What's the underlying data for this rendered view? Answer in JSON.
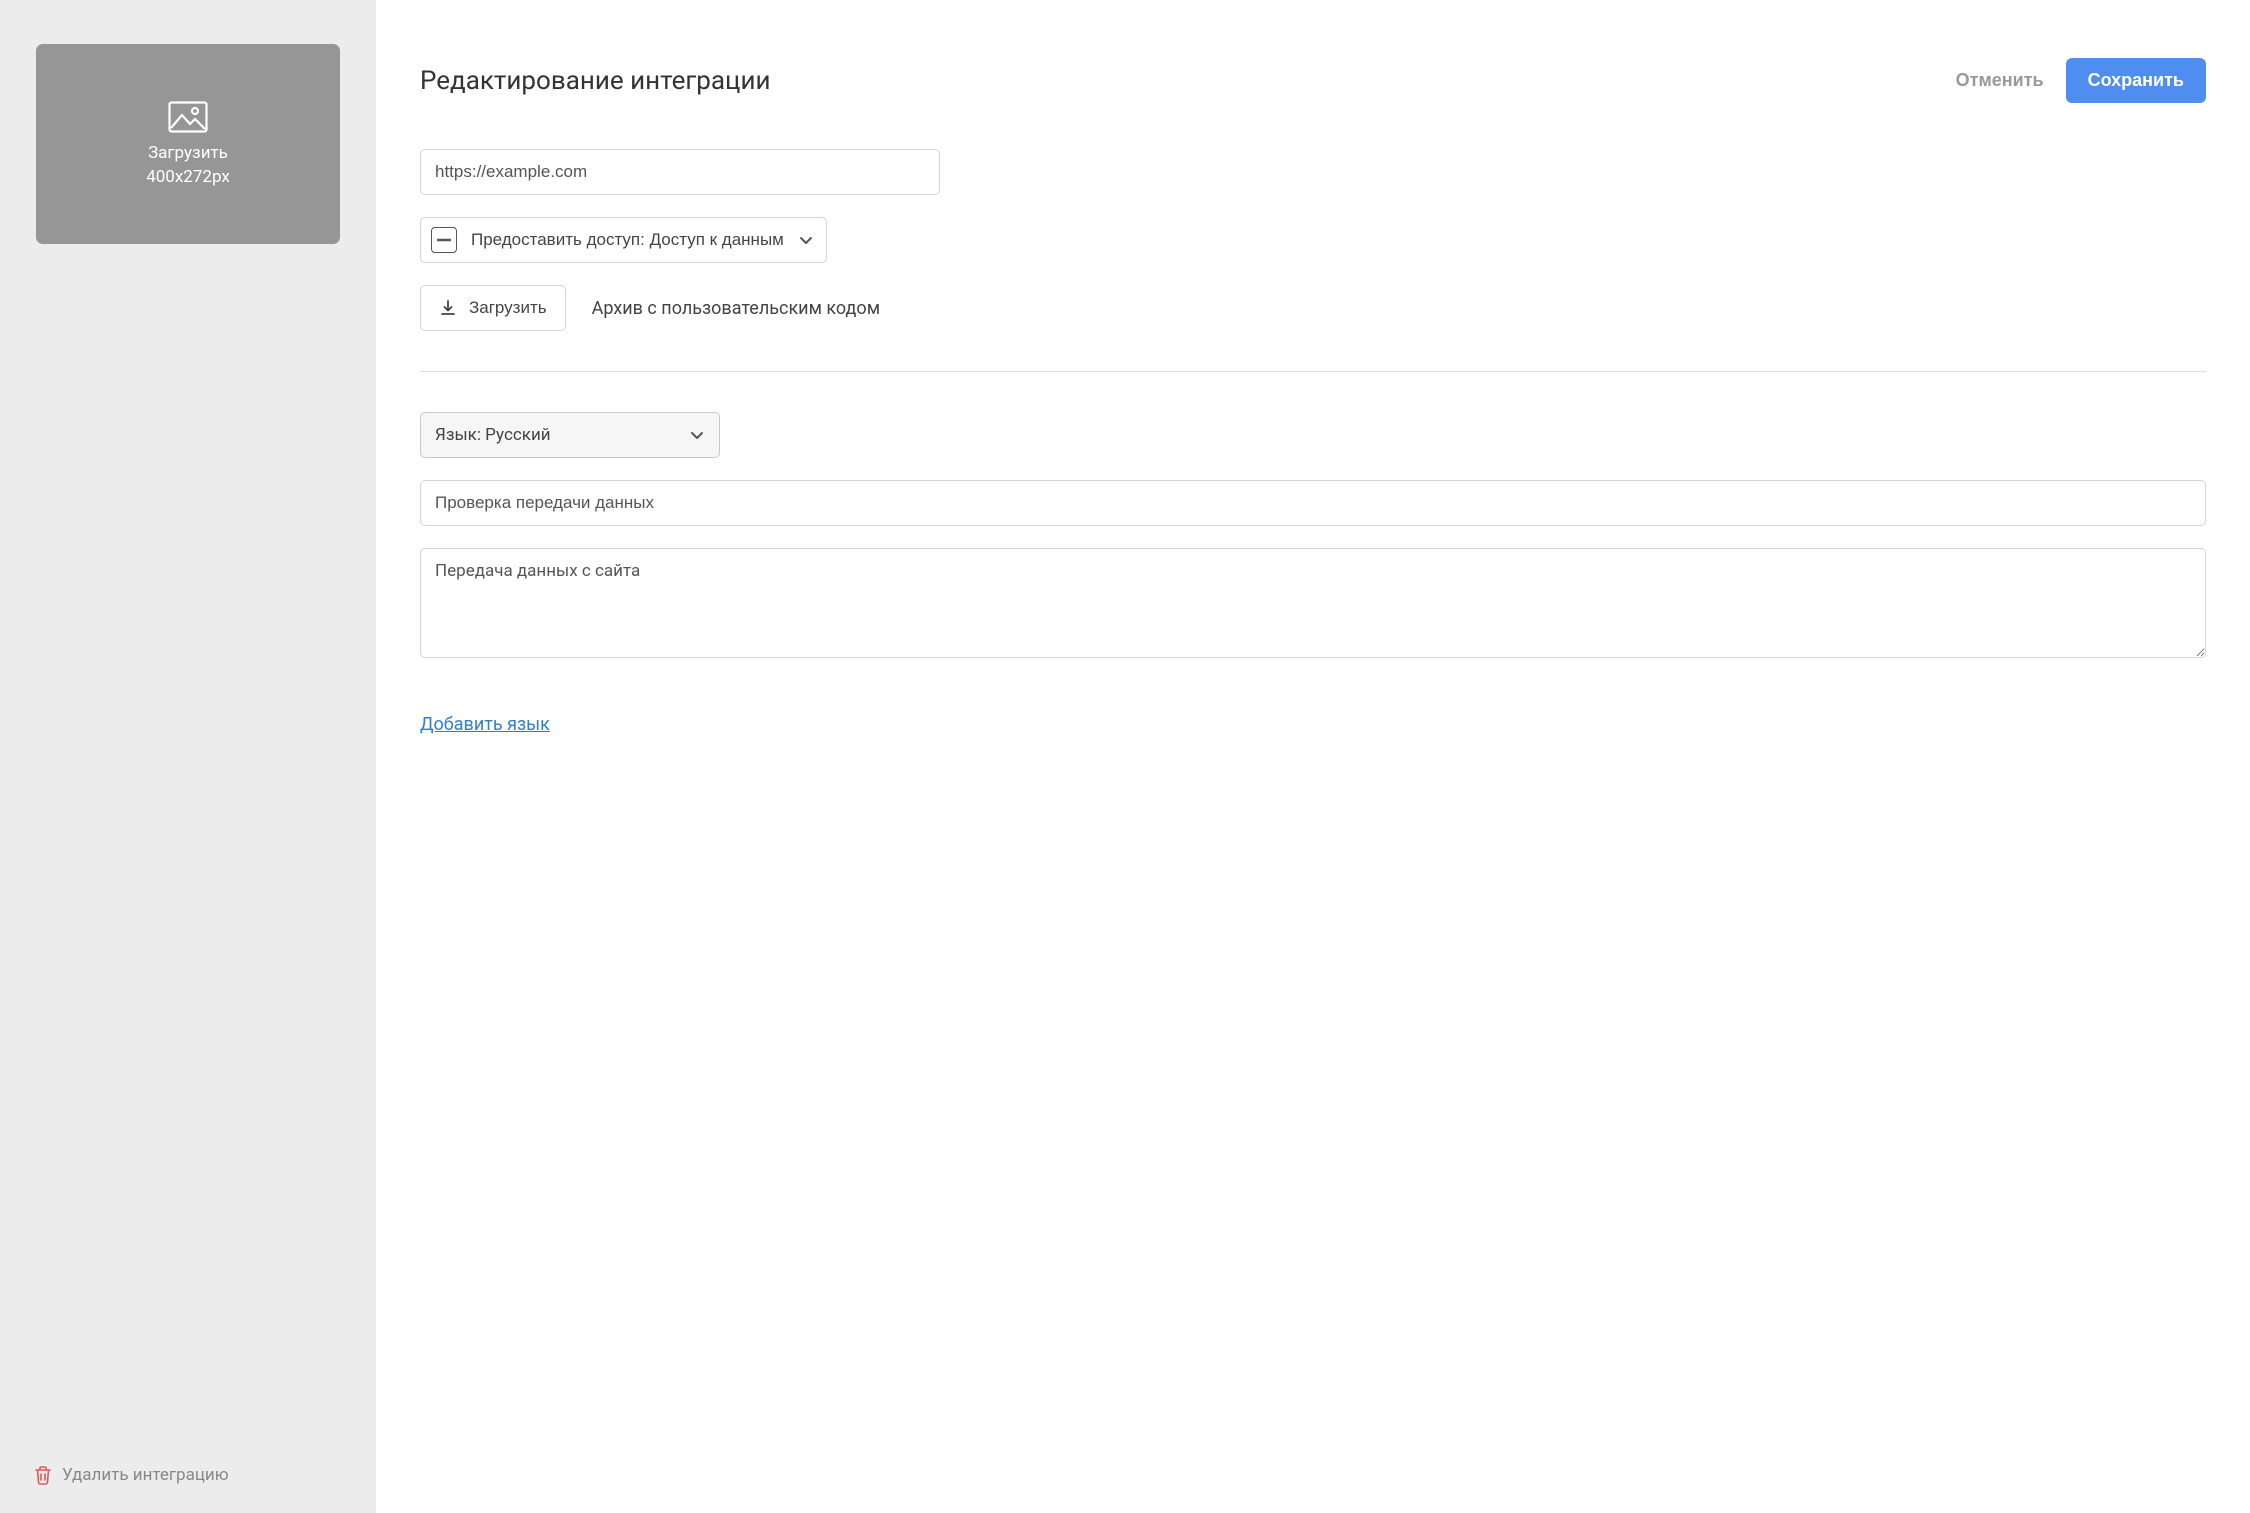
{
  "sidebar": {
    "upload_label": "Загрузить",
    "upload_dimensions": "400x272px",
    "delete_label": "Удалить интеграцию"
  },
  "header": {
    "title": "Редактирование интеграции",
    "cancel_label": "Отменить",
    "save_label": "Сохранить"
  },
  "form": {
    "url_value": "https://example.com",
    "access_label": "Предоставить доступ: Доступ к данным",
    "upload_button": "Загрузить",
    "upload_caption": "Архив с пользовательским кодом",
    "language_label": "Язык: Русский",
    "name_value": "Проверка передачи данных",
    "description_value": "Передача данных с сайта",
    "add_language_label": "Добавить язык"
  }
}
